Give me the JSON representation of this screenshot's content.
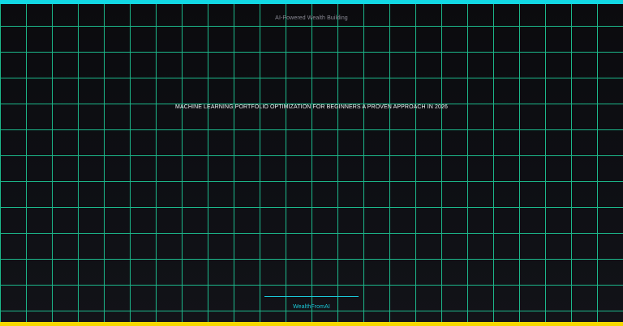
{
  "tagline": "AI-Powered Wealth Building",
  "headline": "MACHINE LEARNING PORTFOLIO OPTIMIZATION FOR BEGINNERS A PROVEN APPROACH IN 2026",
  "brand": "WealthFromAI",
  "colors": {
    "top_bar": "#12d8e4",
    "bottom_bar": "#f5d800",
    "grid_lines": "#1fd6a0",
    "brand_accent": "#1bc8d8",
    "background": "#0c0c10"
  }
}
